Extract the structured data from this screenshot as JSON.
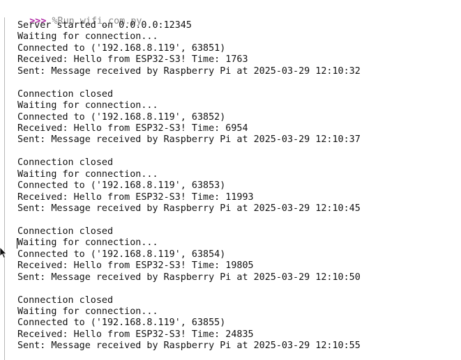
{
  "prompt": {
    "symbol": ">>>",
    "command": "%Run wifi_com.py"
  },
  "output": {
    "header": "Server started on 0.0.0.0:12345",
    "blocks": [
      {
        "closed": "",
        "waiting": "Waiting for connection...",
        "connected": "Connected to ('192.168.8.119', 63851)",
        "received": "Received: Hello from ESP32-S3! Time: 1763",
        "sent": "Sent: Message received by Raspberry Pi at 2025-03-29 12:10:32"
      },
      {
        "closed": "Connection closed",
        "waiting": "Waiting for connection...",
        "connected": "Connected to ('192.168.8.119', 63852)",
        "received": "Received: Hello from ESP32-S3! Time: 6954",
        "sent": "Sent: Message received by Raspberry Pi at 2025-03-29 12:10:37"
      },
      {
        "closed": "Connection closed",
        "waiting": "Waiting for connection...",
        "connected": "Connected to ('192.168.8.119', 63853)",
        "received": "Received: Hello from ESP32-S3! Time: 11993",
        "sent": "Sent: Message received by Raspberry Pi at 2025-03-29 12:10:45"
      },
      {
        "closed": "Connection closed",
        "waiting": "Waiting for connection...",
        "connected": "Connected to ('192.168.8.119', 63854)",
        "received": "Received: Hello from ESP32-S3! Time: 19805",
        "sent": "Sent: Message received by Raspberry Pi at 2025-03-29 12:10:50"
      },
      {
        "closed": "Connection closed",
        "waiting": "Waiting for connection...",
        "connected": "Connected to ('192.168.8.119', 63855)",
        "received": "Received: Hello from ESP32-S3! Time: 24835",
        "sent": "Sent: Message received by Raspberry Pi at 2025-03-29 12:10:55"
      }
    ]
  },
  "colors": {
    "prompt": "#b02aa6",
    "command": "#8a8a8a",
    "text": "#111111",
    "background": "#ffffff"
  },
  "icons": {
    "pointer": "mouse-pointer-icon"
  }
}
